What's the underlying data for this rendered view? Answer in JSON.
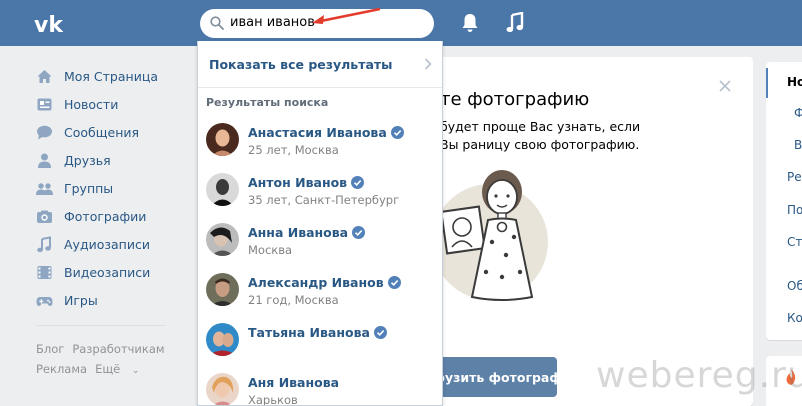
{
  "search": {
    "query": "иван иванов"
  },
  "menu": {
    "items": [
      {
        "label": "Моя Страница",
        "icon": "home-icon"
      },
      {
        "label": "Новости",
        "icon": "news-icon"
      },
      {
        "label": "Сообщения",
        "icon": "messages-icon"
      },
      {
        "label": "Друзья",
        "icon": "friends-icon"
      },
      {
        "label": "Группы",
        "icon": "groups-icon"
      },
      {
        "label": "Фотографии",
        "icon": "photos-icon"
      },
      {
        "label": "Аудиозаписи",
        "icon": "audio-icon"
      },
      {
        "label": "Видеозаписи",
        "icon": "video-icon"
      },
      {
        "label": "Игры",
        "icon": "games-icon"
      }
    ],
    "footer": [
      "Блог",
      "Разработчикам",
      "Реклама",
      "Ещё"
    ]
  },
  "dropdown": {
    "show_all": "Показать все результаты",
    "results_title": "Результаты поиска",
    "results": [
      {
        "name": "Анастасия Иванова",
        "info": "25 лет, Москва",
        "verified": true
      },
      {
        "name": "Антон Иванов",
        "info": "35 лет, Санкт-Петербург",
        "verified": true
      },
      {
        "name": "Анна Иванова",
        "info": "Москва",
        "verified": true
      },
      {
        "name": "Александр Иванов",
        "info": "21 год, Москва",
        "verified": true
      },
      {
        "name": "Татьяна Иванова",
        "info": "",
        "verified": true
      },
      {
        "name": "Аня Иванова",
        "info": "Харьков",
        "verified": false
      }
    ]
  },
  "card": {
    "title": "те фотографию",
    "text": "будет проще Вас узнать, если Вы раницу свою фотографию.",
    "upload_button": "рузить фотографию"
  },
  "right_column": {
    "items": [
      "Но",
      "Ф",
      "В",
      "Ре",
      "По",
      "Ст",
      "Об",
      "Ко"
    ]
  },
  "watermark": "webereg.ru",
  "colors": {
    "header": "#4a76a8",
    "link": "#2a5885",
    "button": "#5e81a8",
    "background": "#edeef0"
  }
}
